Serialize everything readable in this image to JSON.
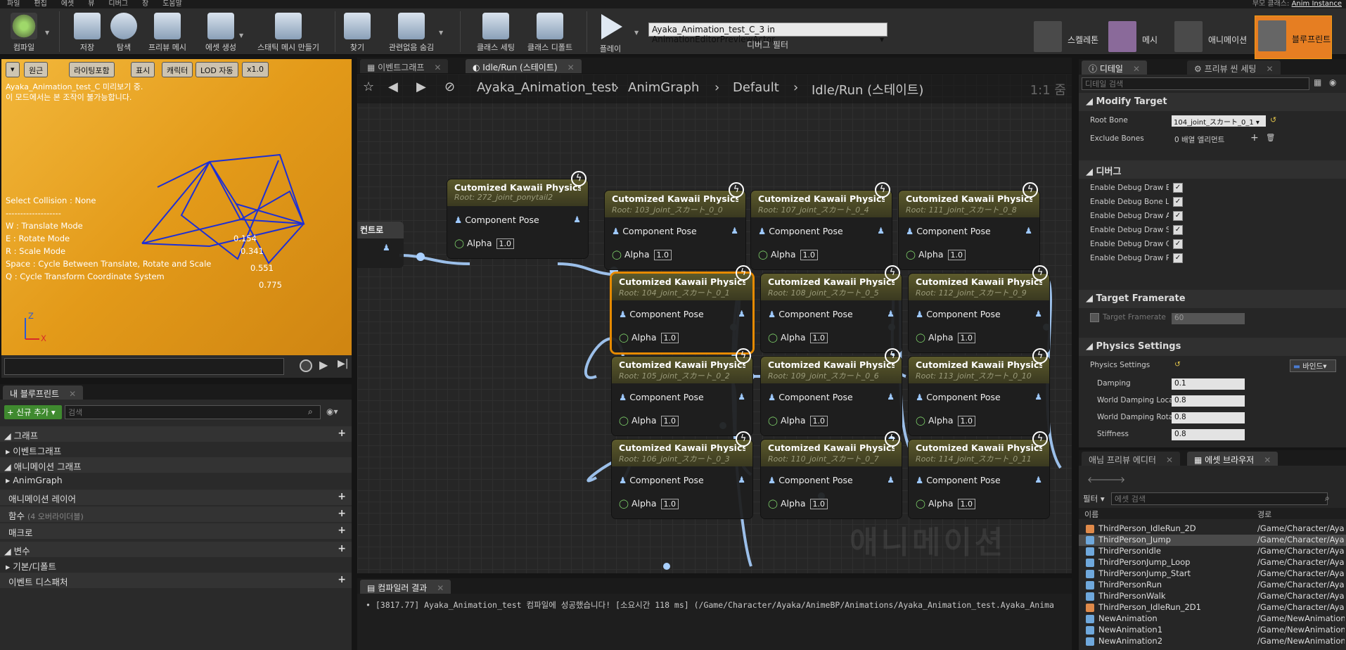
{
  "menu": {
    "items": [
      "파일",
      "편집",
      "에셋",
      "뷰",
      "디버그",
      "창",
      "도움말"
    ],
    "parent_class_label": "부모 클래스:",
    "parent_class": "Anim Instance"
  },
  "toolbar": {
    "buttons": [
      {
        "label": "컴파일",
        "icon": "compile-icon"
      },
      {
        "label": "저장",
        "icon": "save-icon"
      },
      {
        "label": "탐색",
        "icon": "browse-icon"
      },
      {
        "label": "프리뷰 메시",
        "icon": "preview-mesh-icon"
      },
      {
        "label": "에셋 생성",
        "icon": "create-asset-icon"
      },
      {
        "label": "스태틱 메시 만들기",
        "icon": "make-static-mesh-icon"
      },
      {
        "label": "찾기",
        "icon": "find-icon"
      },
      {
        "label": "관련없음 숨김",
        "icon": "hide-unrelated-icon"
      },
      {
        "label": "클래스 세팅",
        "icon": "class-settings-icon"
      },
      {
        "label": "클래스 디폴트",
        "icon": "class-defaults-icon"
      },
      {
        "label": "플레이",
        "icon": "play-icon"
      }
    ],
    "debug_object": "Ayaka_Animation_test_C_3 in AnimationEditorPreviewActor",
    "debug_filter_label": "디버그 필터",
    "modes": [
      {
        "label": "스켈레톤",
        "icon": "skeleton-icon"
      },
      {
        "label": "메시",
        "icon": "mesh-icon"
      },
      {
        "label": "애니메이션",
        "icon": "animation-icon"
      },
      {
        "label": "블루프린트",
        "icon": "blueprint-icon"
      }
    ]
  },
  "viewport": {
    "chips": [
      "원근",
      "라이팅포함",
      "표시",
      "캐릭터",
      "LOD 자동",
      "x1.0"
    ],
    "caption": "Ayaka_Animation_test_C 미리보기 중.\n이 모드에서는 본 조작이 불가능합니다.",
    "help": "Select Collision : None\n-------------------\nW : Translate Mode\nE : Rotate Mode\nR : Scale Mode\nSpace : Cycle Between Translate, Rotate and Scale\nQ : Cycle Transform Coordinate System",
    "labels": [
      "0.154",
      "0.341",
      "0.551",
      "0.775"
    ],
    "axis_z": "Z",
    "axis_x": "X",
    "accent": "#e39a19"
  },
  "my_blueprint": {
    "tab": "내 블루프린트",
    "add_new": "+ 신규 추가",
    "search_placeholder": "검색",
    "rows": [
      {
        "label": "그래프",
        "kind": "section"
      },
      {
        "label": "이벤트그래프",
        "kind": "item"
      },
      {
        "label": "애니메이션 그래프",
        "kind": "section"
      },
      {
        "label": "AnimGraph",
        "kind": "item"
      },
      {
        "label": "애니메이션 레이어",
        "kind": "section"
      },
      {
        "label": "함수",
        "kind": "section",
        "suffix": "(4 오버라이더블)"
      },
      {
        "label": "매크로",
        "kind": "section"
      },
      {
        "label": "변수",
        "kind": "section"
      },
      {
        "label": "기본/디폴트",
        "kind": "item"
      },
      {
        "label": "이벤트 디스패처",
        "kind": "section"
      }
    ]
  },
  "graph": {
    "tabs": [
      "이벤트그래프",
      "Idle/Run (스테이트)"
    ],
    "breadcrumb": [
      "Ayaka_Animation_test",
      "AnimGraph",
      "Default",
      "Idle/Run (스테이트)"
    ],
    "zoom": "1:1 줌",
    "watermark": "애니메이션",
    "output_label": "컨트로",
    "pose_label": "Component Pose",
    "alpha_label": "Alpha",
    "alpha_value": "1.0",
    "nodes": [
      {
        "title": "Cutomized Kawaii Physics",
        "root": "Root: 272_joint_ponytail2"
      },
      {
        "title": "Cutomized Kawaii Physics",
        "root": "Root: 103_joint_スカート_0_0"
      },
      {
        "title": "Cutomized Kawaii Physics",
        "root": "Root: 107_joint_スカート_0_4"
      },
      {
        "title": "Cutomized Kawaii Physics",
        "root": "Root: 111_joint_スカート_0_8"
      },
      {
        "title": "Cutomized Kawaii Physics",
        "root": "Root: 104_joint_スカート_0_1",
        "selected": true
      },
      {
        "title": "Cutomized Kawaii Physics",
        "root": "Root: 108_joint_スカート_0_5"
      },
      {
        "title": "Cutomized Kawaii Physics",
        "root": "Root: 112_joint_スカート_0_9"
      },
      {
        "title": "Cutomized Kawaii Physics",
        "root": "Root: 105_joint_スカート_0_2"
      },
      {
        "title": "Cutomized Kawaii Physics",
        "root": "Root: 109_joint_スカート_0_6"
      },
      {
        "title": "Cutomized Kawaii Physics",
        "root": "Root: 113_joint_スカート_0_10"
      },
      {
        "title": "Cutomized Kawaii Physics",
        "root": "Root: 106_joint_スカート_0_3"
      },
      {
        "title": "Cutomized Kawaii Physics",
        "root": "Root: 110_joint_スカート_0_7"
      },
      {
        "title": "Cutomized Kawaii Physics",
        "root": "Root: 114_joint_スカート_0_11"
      }
    ]
  },
  "compiler": {
    "tab": "컴파일러 결과",
    "message": "[3817.77] Ayaka_Animation_test 컴파일에 성공했습니다! [소요시간 118 ms] (/Game/Character/Ayaka/AnimeBP/Animations/Ayaka_Animation_test.Ayaka_Anima"
  },
  "details": {
    "tabs": [
      "디테일",
      "프리뷰 씬 세팅"
    ],
    "search_placeholder": "디테일 검색",
    "modify_target": {
      "title": "Modify Target",
      "root_bone_label": "Root Bone",
      "root_bone_value": "104_joint_スカート_0_1",
      "exclude_bones_label": "Exclude Bones",
      "exclude_bones_value": "0 배열 엘리먼트"
    },
    "debug": {
      "title": "디버그",
      "items": [
        "Enable Debug Draw Bo",
        "Enable Debug Bone Le",
        "Enable Debug Draw An",
        "Enable Debug Draw Sp",
        "Enable Debug Draw Ca",
        "Enable Debug Draw Pla"
      ]
    },
    "target_framerate": {
      "title": "Target Framerate",
      "label": "Target Framerate",
      "value": "60"
    },
    "physics": {
      "title": "Physics Settings",
      "label": "Physics Settings",
      "bind": "바인드",
      "fields": [
        {
          "label": "Damping",
          "value": "0.1"
        },
        {
          "label": "World Damping Loca",
          "value": "0.8"
        },
        {
          "label": "World Damping Rota",
          "value": "0.8"
        },
        {
          "label": "Stiffness",
          "value": "0.8"
        }
      ]
    }
  },
  "assets": {
    "tabs": [
      "애님 프리뷰 에디터",
      "에셋 브라우저"
    ],
    "filter_label": "필터",
    "search_placeholder": "에셋 검색",
    "col_name": "이름",
    "col_path": "경로",
    "rows": [
      {
        "name": "ThirdPerson_IdleRun_2D",
        "path": "/Game/Character/Aya",
        "color": "#e08a4a"
      },
      {
        "name": "ThirdPerson_Jump",
        "path": "/Game/Character/Aya",
        "color": "#6fa8dc"
      },
      {
        "name": "ThirdPersonIdle",
        "path": "/Game/Character/Aya",
        "color": "#6fa8dc"
      },
      {
        "name": "ThirdPersonJump_Loop",
        "path": "/Game/Character/Aya",
        "color": "#6fa8dc"
      },
      {
        "name": "ThirdPersonJump_Start",
        "path": "/Game/Character/Aya",
        "color": "#6fa8dc"
      },
      {
        "name": "ThirdPersonRun",
        "path": "/Game/Character/Aya",
        "color": "#6fa8dc"
      },
      {
        "name": "ThirdPersonWalk",
        "path": "/Game/Character/Aya",
        "color": "#6fa8dc"
      },
      {
        "name": "ThirdPerson_IdleRun_2D1",
        "path": "/Game/Character/Aya",
        "color": "#e08a4a"
      },
      {
        "name": "NewAnimation",
        "path": "/Game/NewAnimation",
        "color": "#6fa8dc"
      },
      {
        "name": "NewAnimation1",
        "path": "/Game/NewAnimation",
        "color": "#6fa8dc"
      },
      {
        "name": "NewAnimation2",
        "path": "/Game/NewAnimation",
        "color": "#6fa8dc"
      }
    ]
  }
}
